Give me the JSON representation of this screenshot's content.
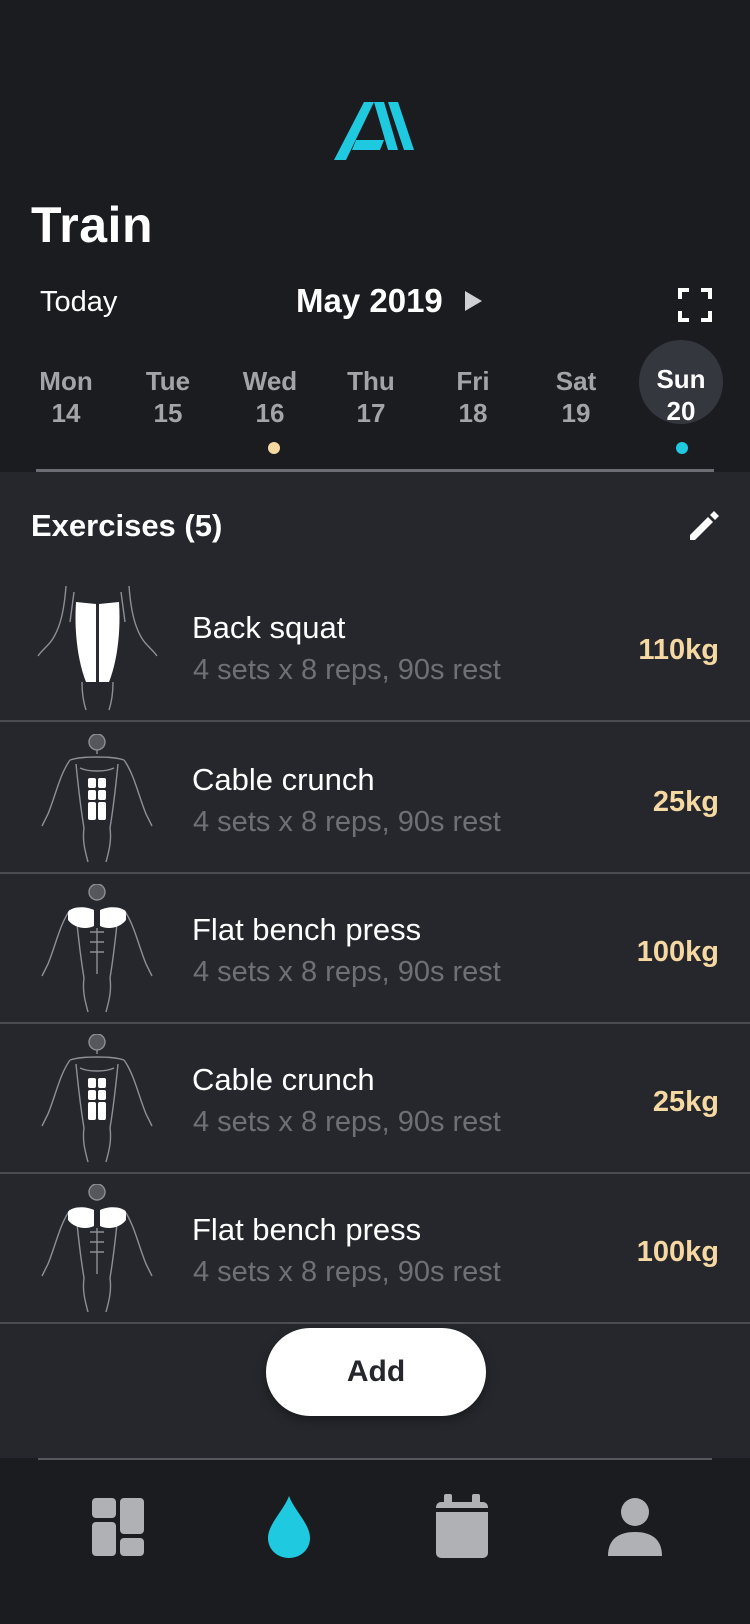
{
  "header": {
    "title": "Train",
    "today_label": "Today",
    "month_label": "May 2019"
  },
  "week": [
    {
      "name": "Mon",
      "date": "14"
    },
    {
      "name": "Tue",
      "date": "15"
    },
    {
      "name": "Wed",
      "date": "16"
    },
    {
      "name": "Thu",
      "date": "17"
    },
    {
      "name": "Fri",
      "date": "18"
    },
    {
      "name": "Sat",
      "date": "19"
    },
    {
      "name": "Sun",
      "date": "20"
    }
  ],
  "selected_day": "Sun 20",
  "colors": {
    "accent_cyan": "#1fc9e0",
    "accent_gold": "#f6d8a2",
    "background": "#1b1c20",
    "card": "#25272c"
  },
  "section": {
    "title": "Exercises (5)",
    "edit_icon": "pencil-icon"
  },
  "exercises": [
    {
      "name": "Back squat",
      "meta": "4 sets x 8 reps, 90s rest",
      "weight": "110kg",
      "muscle": "legs"
    },
    {
      "name": "Cable crunch",
      "meta": "4 sets x 8 reps, 90s rest",
      "weight": "25kg",
      "muscle": "abs"
    },
    {
      "name": "Flat bench press",
      "meta": "4 sets x 8 reps, 90s rest",
      "weight": "100kg",
      "muscle": "chest"
    },
    {
      "name": "Cable crunch",
      "meta": "4 sets x 8 reps, 90s rest",
      "weight": "25kg",
      "muscle": "abs"
    },
    {
      "name": "Flat bench press",
      "meta": "4 sets x 8 reps, 90s rest",
      "weight": "100kg",
      "muscle": "chest"
    }
  ],
  "add_button": {
    "label": "Add"
  },
  "nav": {
    "items": [
      {
        "icon": "dashboard-icon",
        "active": false
      },
      {
        "icon": "drop-icon",
        "active": true
      },
      {
        "icon": "calendar-icon",
        "active": false
      },
      {
        "icon": "profile-icon",
        "active": false
      }
    ]
  }
}
